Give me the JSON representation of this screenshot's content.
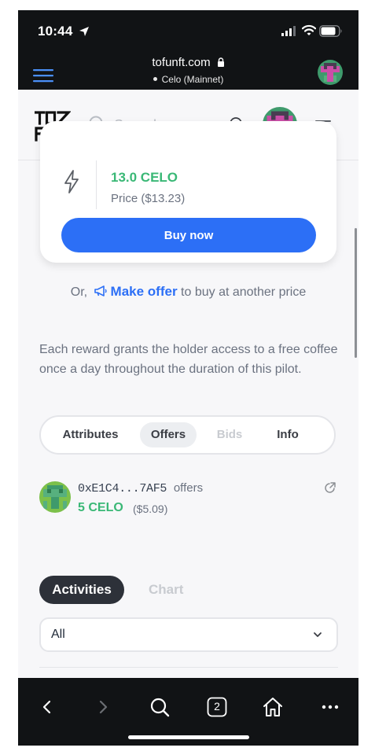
{
  "status_bar": {
    "time": "10:44"
  },
  "browser": {
    "domain": "tofunft.com",
    "network": "Celo (Mainnet)"
  },
  "header": {
    "logo_text": "TOFU NFT",
    "search_placeholder": "Search..."
  },
  "buy_card": {
    "price_celo": "13.0 CELO",
    "price_usd": "Price ($13.23)",
    "buy_label": "Buy now"
  },
  "offer_line": {
    "prefix": "Or,",
    "make_offer": "Make offer",
    "suffix": "to buy at another price"
  },
  "description": "Each reward grants the holder access to a free coffee once a day throughout the duration of this pilot.",
  "tabs": [
    {
      "label": "Attributes",
      "state": "normal"
    },
    {
      "label": "Offers",
      "state": "active"
    },
    {
      "label": "Bids",
      "state": "disabled"
    },
    {
      "label": "Info",
      "state": "normal"
    }
  ],
  "offers": [
    {
      "address": "0xE1C4...7AF5",
      "action": "offers",
      "amount": "5 CELO",
      "usd": "($5.09)"
    }
  ],
  "activity": {
    "tab_activities": "Activities",
    "tab_chart": "Chart",
    "filter_value": "All"
  },
  "toolbar": {
    "tab_count": "2"
  },
  "colors": {
    "accent": "#2c6ff6",
    "price_green": "#3ab876",
    "dark": "#111315"
  }
}
